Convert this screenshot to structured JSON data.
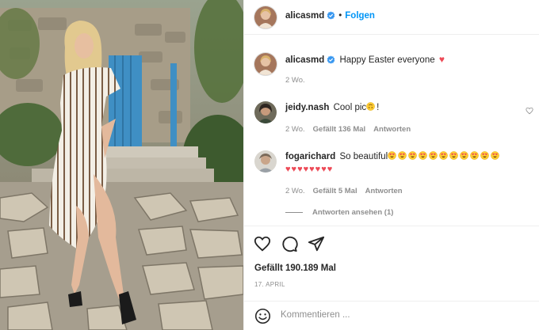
{
  "post": {
    "author": "alicasmd",
    "follow_label": "Folgen",
    "separator": "•",
    "caption": "Happy Easter everyone",
    "caption_time": "2 Wo."
  },
  "comments": [
    {
      "user": "jeidy.nash",
      "text": "Cool pic",
      "time": "2 Wo.",
      "likes": "Gefällt 136 Mal",
      "reply": "Antworten"
    },
    {
      "user": "fogarichard",
      "text": "So beautiful",
      "time": "2 Wo.",
      "likes": "Gefällt 5 Mal",
      "reply": "Antworten",
      "view_replies": "Antworten ansehen (1)"
    }
  ],
  "icons": {
    "like": "heart-icon",
    "comment": "comment-icon",
    "share": "share-icon",
    "emoji": "emoji-icon",
    "verified": "verified-badge-icon"
  },
  "stats": {
    "likes": "Gefällt 190.189 Mal",
    "date": "17. APRIL"
  },
  "composer": {
    "placeholder": "Kommentieren ..."
  },
  "colors": {
    "accent": "#0095f6",
    "heart": "#ed4956",
    "muted": "#8e8e8e"
  }
}
